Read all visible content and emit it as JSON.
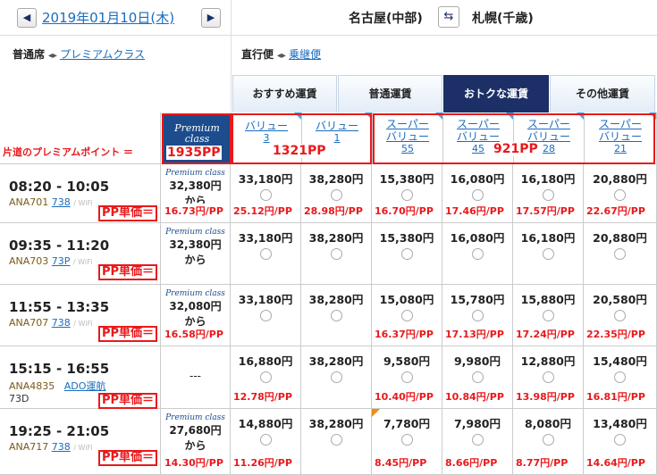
{
  "header": {
    "prev_icon": "chevron-left-icon",
    "next_icon": "chevron-right-icon",
    "date": "2019年01月10日(木)",
    "from": "名古屋(中部)",
    "to": "札幌(千歳)",
    "swap_icon": "swap-icon"
  },
  "options": {
    "seat_current": "普通席",
    "seat_alt": "プレミアムクラス",
    "route_current": "直行便",
    "route_alt": "乗継便"
  },
  "tabs": [
    "おすすめ運賃",
    "普通運賃",
    "おトクな運賃",
    "その他運賃"
  ],
  "active_tab": 2,
  "fare_columns": [
    {
      "name": "バリュー",
      "num": "3"
    },
    {
      "name": "バリュー",
      "num": "1"
    },
    {
      "name": "スーパーバリュー",
      "num": "55"
    },
    {
      "name": "スーパーバリュー",
      "num": "45"
    },
    {
      "name": "スーパーバリュー",
      "num": "28"
    },
    {
      "name": "スーパーバリュー",
      "num": "21"
    }
  ],
  "premium_header": "Premium class",
  "annotations": {
    "row_label": "片道のプレミアムポイント ＝",
    "pp_premium": "1935PP",
    "pp_value": "1321PP",
    "pp_super": "921PP",
    "pp_unit_label": "PP単価＝"
  },
  "flights": [
    {
      "time": "08:20 - 10:05",
      "flight": "ANA701",
      "aircraft": "738",
      "premium_logo": "Premium class",
      "premium_price": "32,380円",
      "premium_from": "から",
      "premium_ppu": "16.73円/PP",
      "prices": [
        "33,180円",
        "38,280円",
        "15,380円",
        "16,080円",
        "16,180円",
        "20,880円"
      ],
      "ppu": [
        "25.12円/PP",
        "28.98円/PP",
        "16.70円/PP",
        "17.46円/PP",
        "17.57円/PP",
        "22.67円/PP"
      ]
    },
    {
      "time": "09:35 - 11:20",
      "flight": "ANA703",
      "aircraft": "73P",
      "premium_logo": "Premium class",
      "premium_price": "32,380円",
      "premium_from": "から",
      "premium_ppu": "",
      "prices": [
        "33,180円",
        "38,280円",
        "15,380円",
        "16,080円",
        "16,180円",
        "20,880円"
      ],
      "ppu": [
        "",
        "",
        "",
        "",
        "",
        ""
      ]
    },
    {
      "time": "11:55 - 13:35",
      "flight": "ANA707",
      "aircraft": "738",
      "premium_logo": "Premium class",
      "premium_price": "32,080円",
      "premium_from": "から",
      "premium_ppu": "16.58円/PP",
      "prices": [
        "33,180円",
        "38,280円",
        "15,080円",
        "15,780円",
        "15,880円",
        "20,580円"
      ],
      "ppu": [
        "",
        "",
        "16.37円/PP",
        "17.13円/PP",
        "17.24円/PP",
        "22.35円/PP"
      ]
    },
    {
      "time": "15:15 - 16:55",
      "flight": "ANA4835",
      "aircraft": "73D",
      "codeshare": "ADO運航",
      "premium_logo": "",
      "premium_price": "---",
      "premium_from": "",
      "premium_ppu": "",
      "prices": [
        "16,880円",
        "38,280円",
        "9,580円",
        "9,980円",
        "12,880円",
        "15,480円"
      ],
      "ppu": [
        "12.78円/PP",
        "",
        "10.40円/PP",
        "10.84円/PP",
        "13.98円/PP",
        "16.81円/PP"
      ]
    },
    {
      "time": "19:25 - 21:05",
      "flight": "ANA717",
      "aircraft": "738",
      "premium_logo": "Premium class",
      "premium_price": "27,680円",
      "premium_from": "から",
      "premium_ppu": "14.30円/PP",
      "prices": [
        "14,880円",
        "38,280円",
        "7,780円",
        "7,980円",
        "8,080円",
        "13,480円"
      ],
      "ppu": [
        "11.26円/PP",
        "",
        "8.45円/PP",
        "8.66円/PP",
        "8.77円/PP",
        "14.64円/PP"
      ]
    }
  ]
}
